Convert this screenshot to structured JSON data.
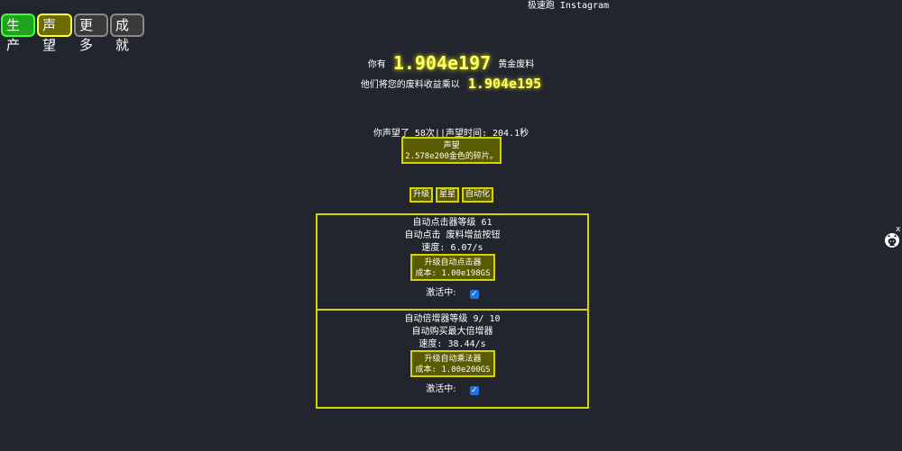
{
  "header": {
    "instagram_link": "极速跑 Instagram"
  },
  "tabs": [
    "生产",
    "声望",
    "更多",
    "成就"
  ],
  "scrap": {
    "you_have": "你有",
    "amount": "1.904e197",
    "unit": "黄金废料",
    "multiplier_text": "他们将您的废料收益乘以",
    "multiplier": "1.904e195"
  },
  "prestige": {
    "info": "你声望了 58次||声望时间:  204.1秒",
    "button_title": "声望",
    "button_reward": "2.578e200金色的碎片。"
  },
  "subtabs": [
    "升级",
    "星星",
    "自动化"
  ],
  "autoclicker": {
    "level_text": "自动点击器等级 61",
    "desc": "自动点击 废料增益按钮",
    "speed": "速度:  6.07/s",
    "button_title": "升级自动点击器",
    "button_cost": "成本:  1.00e198GS",
    "active_label": "激活中:",
    "active": true
  },
  "automultiplier": {
    "level_text": "自动倍增器等级 9/ 10",
    "desc": "自动购买最大倍增器",
    "speed": "速度:  38.44/s",
    "button_title": "升级自动乘法器",
    "button_cost": "成本:  1.00e200GS",
    "active_label": "激活中:",
    "active": true
  },
  "corner": {
    "close": "x",
    "octocat_icon": "github-octocat-icon"
  },
  "colors": {
    "background": "#22252e",
    "accent_yellow": "#ffff66",
    "button_border": "#d4d400",
    "button_fill": "#5a5a00",
    "tab_green": "#22a31f",
    "checkbox_blue": "#1b74e8"
  }
}
